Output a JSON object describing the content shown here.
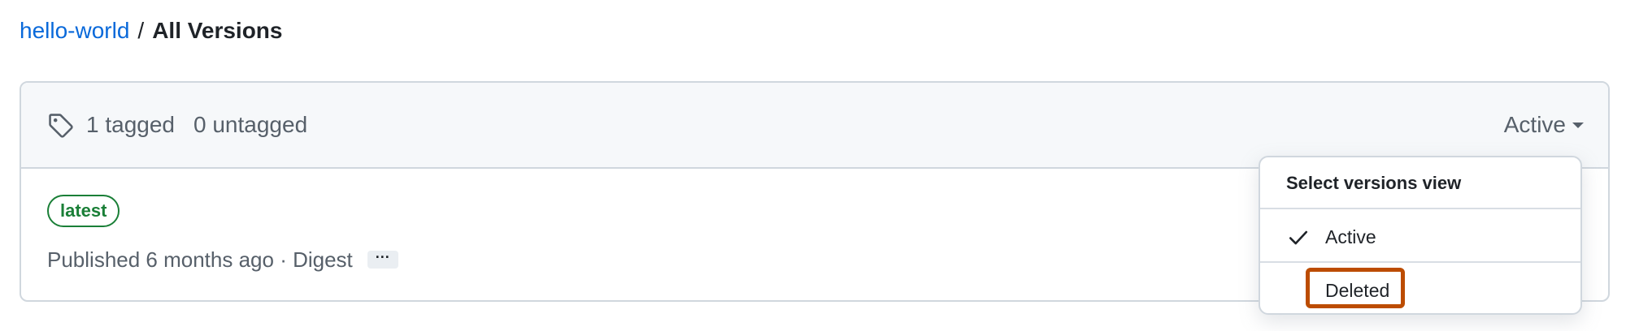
{
  "breadcrumb": {
    "repo": "hello-world",
    "separator": "/",
    "current": "All Versions"
  },
  "filters": {
    "tagged": "1 tagged",
    "untagged": "0 untagged",
    "view_label": "Active"
  },
  "version": {
    "badge": "latest",
    "published": "Published 6 months ago · Digest",
    "more": "···"
  },
  "menu": {
    "title": "Select versions view",
    "items": [
      {
        "label": "Active",
        "selected": true
      },
      {
        "label": "Deleted",
        "selected": false
      }
    ]
  },
  "colors": {
    "link": "#0969da",
    "badge": "#1a7f37",
    "highlight": "#bc4c00"
  },
  "icons": {
    "tag": "tag-icon",
    "check": "check-icon",
    "caret": "caret-down-icon"
  }
}
